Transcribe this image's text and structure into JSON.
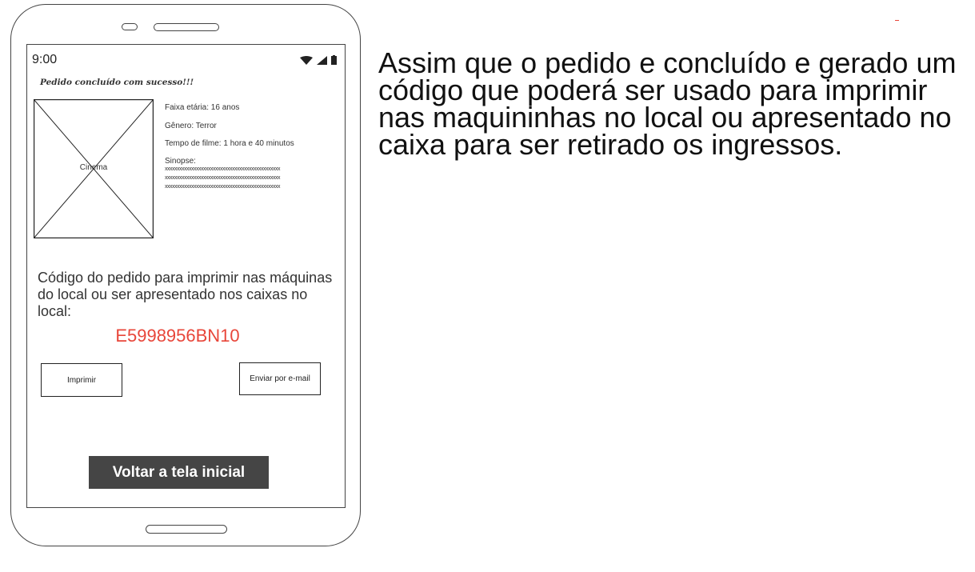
{
  "status_bar": {
    "time": "9:00"
  },
  "screen": {
    "success_message": "Pedido concluído com sucesso!!!",
    "poster_label": "Cinema",
    "details": {
      "age_rating": "Faixa etária: 16 anos",
      "genre": "Gênero: Terror",
      "duration": "Tempo de filme: 1 hora e 40 minutos",
      "synopsis_label": "Sinopse:",
      "synopsis_lines": [
        "xxxxxxxxxxxxxxxxxxxxxxxxxxxxxxxxxxxxxxxxxxxxxxxx",
        "xxxxxxxxxxxxxxxxxxxxxxxxxxxxxxxxxxxxxxxxxxxxxxxx",
        "xxxxxxxxxxxxxxxxxxxxxxxxxxxxxxxxxxxxxxxxxxxxxxxx"
      ]
    },
    "code_instructions": "Código do pedido para imprimir nas máquinas do local ou ser apresentado nos caixas no local:",
    "order_code": "E5998956BN10",
    "print_button": "Imprimir",
    "email_button": "Enviar por e-mail",
    "back_button": "Voltar a tela inicial"
  },
  "description": "Assim que o pedido e concluído e gerado um código que poderá ser usado para imprimir nas maquininhas no local ou apresentado no caixa para ser retirado os ingressos.",
  "colors": {
    "accent_red": "#e8463a",
    "dark_button": "#454545"
  }
}
